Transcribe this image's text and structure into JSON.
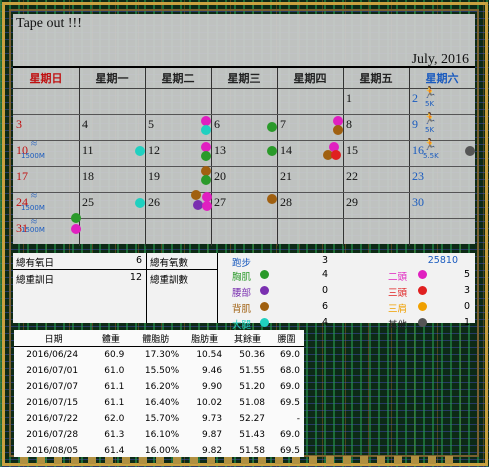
{
  "calendar": {
    "title": "Tape out !!!",
    "month": "July, 2016",
    "weekdays": [
      "星期日",
      "星期一",
      "星期二",
      "星期三",
      "星期四",
      "星期五",
      "星期六"
    ],
    "weeks": [
      [
        "",
        "",
        "",
        "",
        "",
        "1",
        "2"
      ],
      [
        "3",
        "4",
        "5",
        "6",
        "7",
        "8",
        "9"
      ],
      [
        "10",
        "11",
        "12",
        "13",
        "14",
        "15",
        "16"
      ],
      [
        "17",
        "18",
        "19",
        "20",
        "21",
        "22",
        "23"
      ],
      [
        "24",
        "25",
        "26",
        "27",
        "28",
        "29",
        "30"
      ],
      [
        "31",
        "",
        "",
        "",
        "",
        "",
        ""
      ]
    ],
    "notes": {
      "sat2": "5K",
      "sat9": "5K",
      "sat16": "5.5K",
      "sun10": "1500M",
      "sun24": "1500M",
      "sun31": "1500M"
    },
    "colors": {
      "green": "#2a9a2a",
      "purple": "#7a30b0",
      "brown": "#a06010",
      "cyan": "#20d0c0",
      "magenta": "#e020c0",
      "red": "#e02020",
      "orange": "#f0a000",
      "gray": "#555555"
    }
  },
  "summary": {
    "aerobic_days_label": "總有氧日",
    "aerobic_days": "6",
    "strength_days_label": "總重訓日",
    "strength_days": "12",
    "aerobic_count_label": "總有氧數",
    "strength_count_label": "總重訓數",
    "running_label": "跑步",
    "running_count": "3",
    "running_distance": "25810",
    "left_parts": [
      {
        "label": "胸肌",
        "count": "4",
        "color": "#2a9a2a"
      },
      {
        "label": "腰部",
        "count": "0",
        "color": "#7a30b0"
      },
      {
        "label": "背肌",
        "count": "6",
        "color": "#a06010"
      },
      {
        "label": "大腿",
        "count": "4",
        "color": "#20d0c0"
      }
    ],
    "right_parts": [
      {
        "label": "二頭",
        "count": "5",
        "color": "#e020c0"
      },
      {
        "label": "三頭",
        "count": "3",
        "color": "#e02020"
      },
      {
        "label": "三肩",
        "count": "0",
        "color": "#f0a000"
      },
      {
        "label": "其他",
        "count": "1",
        "color": "#555555"
      }
    ]
  },
  "weights": {
    "headers": [
      "日期",
      "體重",
      "體脂肪",
      "脂肪重",
      "其餘重",
      "腰圍"
    ],
    "rows": [
      [
        "2016/06/24",
        "60.9",
        "17.30%",
        "10.54",
        "50.36",
        "69.0"
      ],
      [
        "2016/07/01",
        "61.0",
        "15.50%",
        "9.46",
        "51.55",
        "68.0"
      ],
      [
        "2016/07/07",
        "61.1",
        "16.20%",
        "9.90",
        "51.20",
        "69.0"
      ],
      [
        "2016/07/15",
        "61.1",
        "16.40%",
        "10.02",
        "51.08",
        "69.5"
      ],
      [
        "2016/07/22",
        "62.0",
        "15.70%",
        "9.73",
        "52.27",
        "-"
      ],
      [
        "2016/07/28",
        "61.3",
        "16.10%",
        "9.87",
        "51.43",
        "69.0"
      ],
      [
        "2016/08/05",
        "61.4",
        "16.00%",
        "9.82",
        "51.58",
        "69.5"
      ]
    ]
  }
}
